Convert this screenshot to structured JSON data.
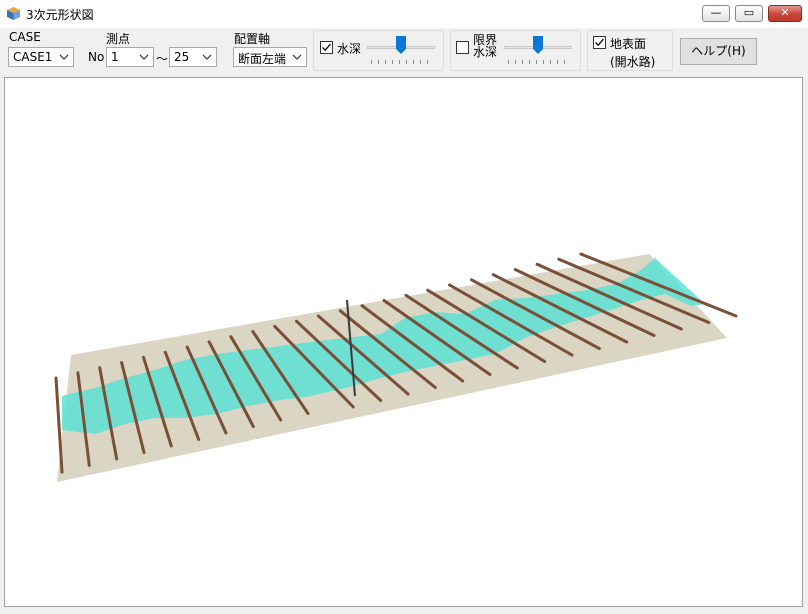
{
  "window": {
    "title": "3次元形状図",
    "buttons": {
      "minimize": "—",
      "maximize": "▭",
      "close": "✕"
    }
  },
  "toolbar": {
    "case": {
      "label": "CASE",
      "value": "CASE1"
    },
    "station": {
      "label": "測点",
      "prefix": "No",
      "from": "1",
      "separator": "〜",
      "to": "25"
    },
    "axis": {
      "label": "配置軸",
      "value": "断面左端"
    },
    "water_depth": {
      "checked": true,
      "label": "水深",
      "level": 0.5
    },
    "critical_depth": {
      "checked": false,
      "label_line1": "限界",
      "label_line2": "水深",
      "level": 0.5
    },
    "ground_surface": {
      "checked": true,
      "label_line1": "地表面",
      "label_line2": "(開水路)"
    },
    "help": {
      "label": "ヘルプ(H)"
    }
  },
  "scene": {
    "colors": {
      "ground": "#dad6c3",
      "water": "#5ce0d4",
      "post": "#7a4f38"
    },
    "section_count": 25
  }
}
